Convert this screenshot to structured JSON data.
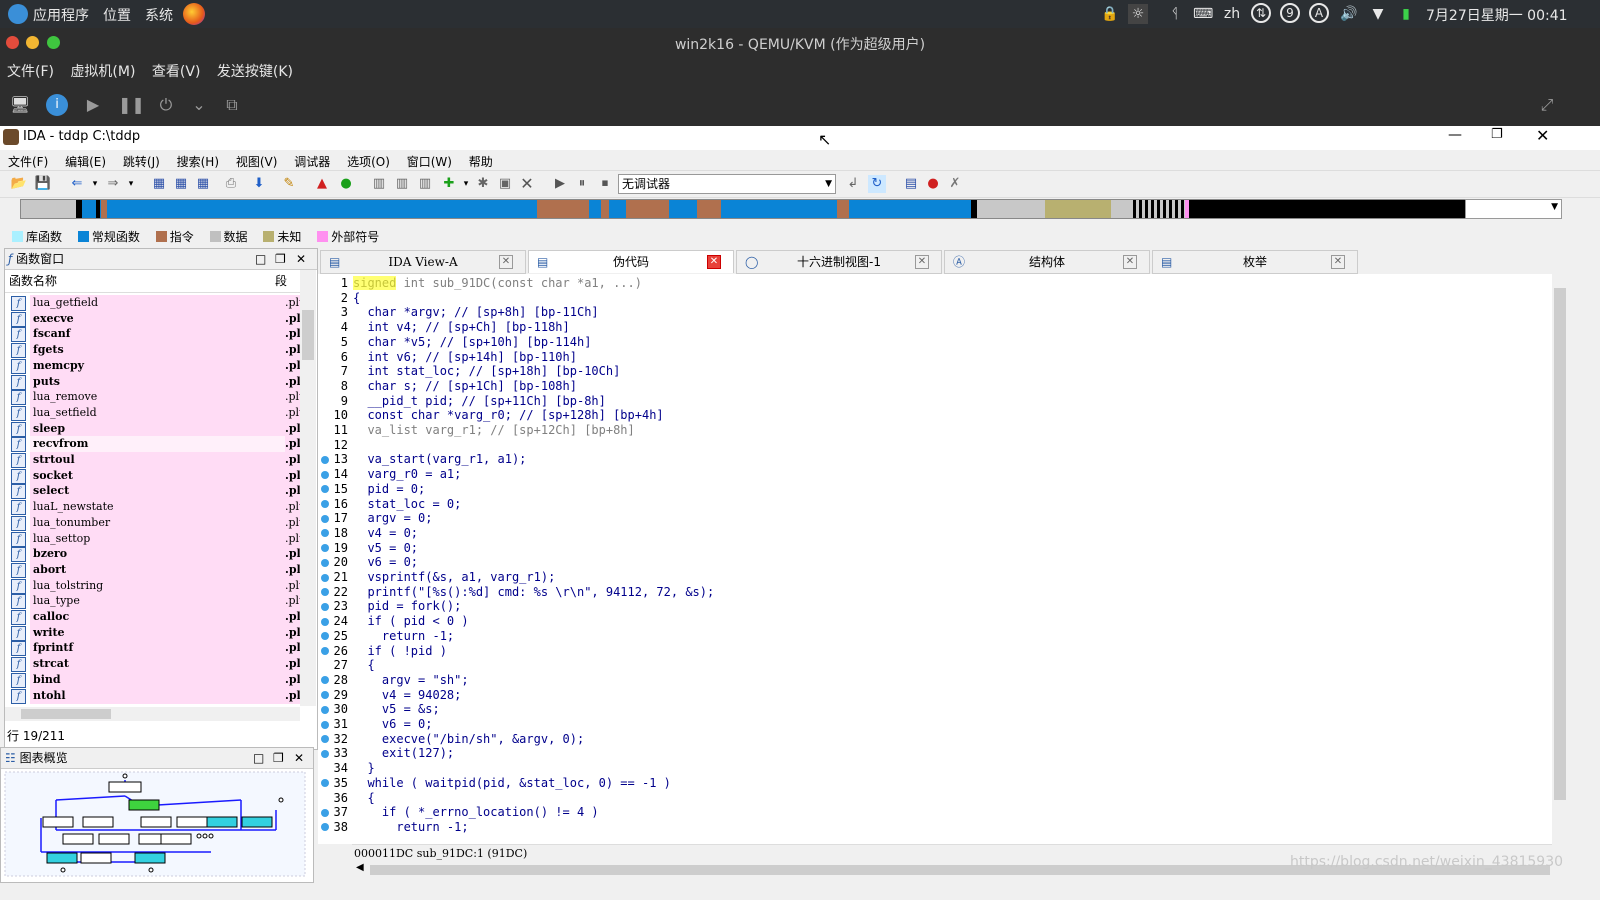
{
  "system_panel": {
    "menus": [
      "应用程序",
      "位置",
      "系统"
    ],
    "lang": "zh",
    "circle_indicators": [
      "9",
      "A"
    ],
    "clock": "7月27日星期一 00:41"
  },
  "qemu": {
    "title": "win2k16 - QEMU/KVM (作为超级用户)",
    "menus": [
      "文件(F)",
      "虚拟机(M)",
      "查看(V)",
      "发送按键(K)"
    ]
  },
  "ida": {
    "title": "IDA - tddp C:\\tddp",
    "menus": [
      "文件(F)",
      "编辑(E)",
      "跳转(J)",
      "搜索(H)",
      "视图(V)",
      "调试器",
      "选项(O)",
      "窗口(W)",
      "帮助"
    ],
    "debugger_select": "无调试器",
    "legend": [
      {
        "label": "库函数",
        "color": "#aaf0ff"
      },
      {
        "label": "常规函数",
        "color": "#0a84d6"
      },
      {
        "label": "指令",
        "color": "#b0704e"
      },
      {
        "label": "数据",
        "color": "#c0c0c0"
      },
      {
        "label": "未知",
        "color": "#b8b070"
      },
      {
        "label": "外部符号",
        "color": "#ff90f0"
      }
    ],
    "func_window": {
      "title": "函数窗口",
      "col_name": "函数名称",
      "col_seg": "段",
      "functions": [
        {
          "name": "lua_getfield",
          "seg": ".plt"
        },
        {
          "name": "execve",
          "seg": ".pl"
        },
        {
          "name": "fscanf",
          "seg": ".pl"
        },
        {
          "name": "fgets",
          "seg": ".pl"
        },
        {
          "name": "memcpy",
          "seg": ".pl"
        },
        {
          "name": "puts",
          "seg": ".pl"
        },
        {
          "name": "lua_remove",
          "seg": ".plt"
        },
        {
          "name": "lua_setfield",
          "seg": ".plt"
        },
        {
          "name": "sleep",
          "seg": ".pl"
        },
        {
          "name": "recvfrom",
          "seg": ".pl"
        },
        {
          "name": "strtoul",
          "seg": ".pl"
        },
        {
          "name": "socket",
          "seg": ".pl"
        },
        {
          "name": "select",
          "seg": ".pl"
        },
        {
          "name": "luaL_newstate",
          "seg": ".plt"
        },
        {
          "name": "lua_tonumber",
          "seg": ".plt"
        },
        {
          "name": "lua_settop",
          "seg": ".plt"
        },
        {
          "name": "bzero",
          "seg": ".pl"
        },
        {
          "name": "abort",
          "seg": ".pl"
        },
        {
          "name": "lua_tolstring",
          "seg": ".plt"
        },
        {
          "name": "lua_type",
          "seg": ".plt"
        },
        {
          "name": "calloc",
          "seg": ".pl"
        },
        {
          "name": "write",
          "seg": ".pl"
        },
        {
          "name": "fprintf",
          "seg": ".pl"
        },
        {
          "name": "strcat",
          "seg": ".pl"
        },
        {
          "name": "bind",
          "seg": ".pl"
        },
        {
          "name": "ntohl",
          "seg": ".pl"
        }
      ],
      "status": "行 19/211"
    },
    "graph_overview": {
      "title": "图表概览"
    },
    "tabs": [
      "IDA View-A",
      "伪代码",
      "十六进制视图-1",
      "结构体",
      "枚举"
    ],
    "status_line": "000011DC sub_91DC:1 (91DC)",
    "watermark": "https://blog.csdn.net/weixin_43815930",
    "code": [
      {
        "n": "1",
        "t": "signed int sub_91DC(const char *a1, ...)",
        "bp": false
      },
      {
        "n": "2",
        "t": "{",
        "bp": false
      },
      {
        "n": "3",
        "t": "  char *argv; // [sp+8h] [bp-11Ch]",
        "bp": false
      },
      {
        "n": "4",
        "t": "  int v4; // [sp+Ch] [bp-118h]",
        "bp": false
      },
      {
        "n": "5",
        "t": "  char *v5; // [sp+10h] [bp-114h]",
        "bp": false
      },
      {
        "n": "6",
        "t": "  int v6; // [sp+14h] [bp-110h]",
        "bp": false
      },
      {
        "n": "7",
        "t": "  int stat_loc; // [sp+18h] [bp-10Ch]",
        "bp": false
      },
      {
        "n": "8",
        "t": "  char s; // [sp+1Ch] [bp-108h]",
        "bp": false
      },
      {
        "n": "9",
        "t": "  __pid_t pid; // [sp+11Ch] [bp-8h]",
        "bp": false
      },
      {
        "n": "10",
        "t": "  const char *varg_r0; // [sp+128h] [bp+4h]",
        "bp": false
      },
      {
        "n": "11",
        "t": "  va_list varg_r1; // [sp+12Ch] [bp+8h]",
        "bp": false
      },
      {
        "n": "12",
        "t": "",
        "bp": false
      },
      {
        "n": "13",
        "t": "  va_start(varg_r1, a1);",
        "bp": true
      },
      {
        "n": "14",
        "t": "  varg_r0 = a1;",
        "bp": true
      },
      {
        "n": "15",
        "t": "  pid = 0;",
        "bp": true
      },
      {
        "n": "16",
        "t": "  stat_loc = 0;",
        "bp": true
      },
      {
        "n": "17",
        "t": "  argv = 0;",
        "bp": true
      },
      {
        "n": "18",
        "t": "  v4 = 0;",
        "bp": true
      },
      {
        "n": "19",
        "t": "  v5 = 0;",
        "bp": true
      },
      {
        "n": "20",
        "t": "  v6 = 0;",
        "bp": true
      },
      {
        "n": "21",
        "t": "  vsprintf(&s, a1, varg_r1);",
        "bp": true
      },
      {
        "n": "22",
        "t": "  printf(\"[%s():%d] cmd: %s \\r\\n\", 94112, 72, &s);",
        "bp": true
      },
      {
        "n": "23",
        "t": "  pid = fork();",
        "bp": true
      },
      {
        "n": "24",
        "t": "  if ( pid < 0 )",
        "bp": true
      },
      {
        "n": "25",
        "t": "    return -1;",
        "bp": true
      },
      {
        "n": "26",
        "t": "  if ( !pid )",
        "bp": true
      },
      {
        "n": "27",
        "t": "  {",
        "bp": false
      },
      {
        "n": "28",
        "t": "    argv = \"sh\";",
        "bp": true
      },
      {
        "n": "29",
        "t": "    v4 = 94028;",
        "bp": true
      },
      {
        "n": "30",
        "t": "    v5 = &s;",
        "bp": true
      },
      {
        "n": "31",
        "t": "    v6 = 0;",
        "bp": true
      },
      {
        "n": "32",
        "t": "    execve(\"/bin/sh\", &argv, 0);",
        "bp": true
      },
      {
        "n": "33",
        "t": "    exit(127);",
        "bp": true
      },
      {
        "n": "34",
        "t": "  }",
        "bp": false
      },
      {
        "n": "35",
        "t": "  while ( waitpid(pid, &stat_loc, 0) == -1 )",
        "bp": true
      },
      {
        "n": "36",
        "t": "  {",
        "bp": false
      },
      {
        "n": "37",
        "t": "    if ( *_errno_location() != 4 )",
        "bp": true
      },
      {
        "n": "38",
        "t": "      return -1;",
        "bp": true
      }
    ]
  }
}
